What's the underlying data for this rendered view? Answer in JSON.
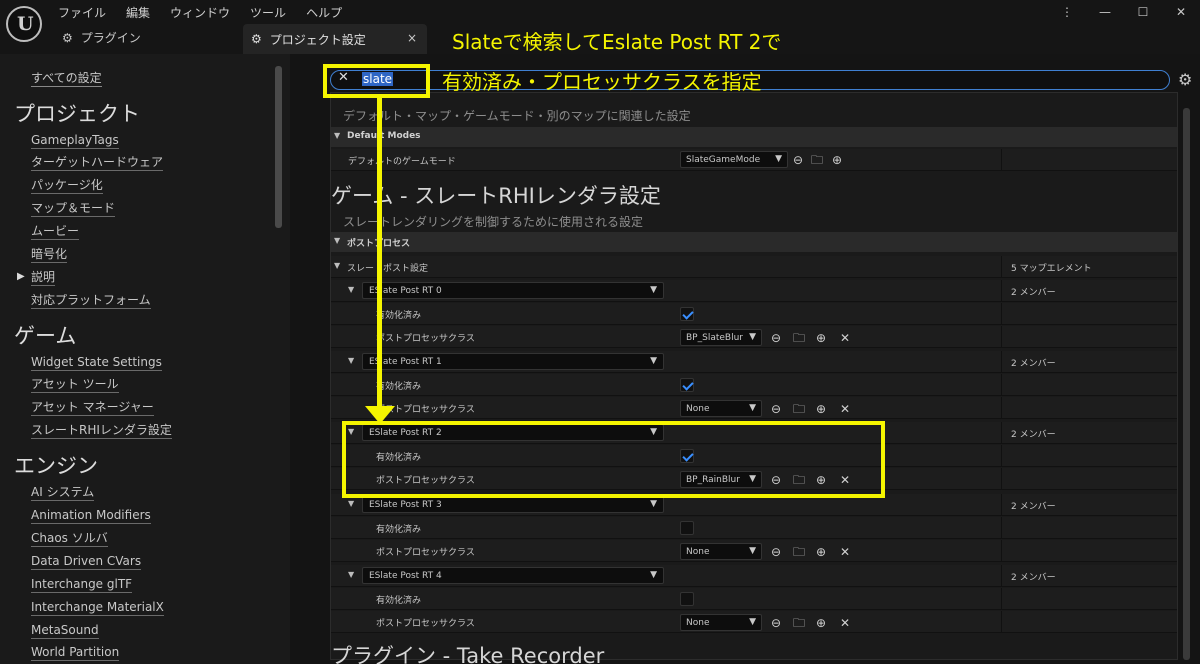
{
  "menu": [
    "ファイル",
    "編集",
    "ウィンドウ",
    "ツール",
    "ヘルプ"
  ],
  "window_controls": [
    "⋮",
    "—",
    "☐",
    "✕"
  ],
  "tabs": {
    "plugin": "プラグイン",
    "project": "プロジェクト設定",
    "close": "×"
  },
  "sidebar": {
    "all": "すべての設定",
    "project_title": "プロジェクト",
    "project_items": [
      "GameplayTags",
      "ターゲットハードウェア",
      "パッケージ化",
      "マップ＆モード",
      "ムービー",
      "暗号化",
      "説明",
      "対応プラットフォーム"
    ],
    "game_title": "ゲーム",
    "game_items": [
      "Widget State Settings",
      "アセット ツール",
      "アセット マネージャー",
      "スレートRHIレンダラ設定"
    ],
    "engine_title": "エンジン",
    "engine_items": [
      "AI システム",
      "Animation Modifiers",
      "Chaos ソルバ",
      "Data Driven CVars",
      "Interchange glTF",
      "Interchange MaterialX",
      "MetaSound",
      "World Partition"
    ]
  },
  "search": {
    "value": "slate"
  },
  "content": {
    "maps_desc": "デフォルト・マップ・ゲームモード・別のマップに関連した設定",
    "default_modes": "Default Modes",
    "default_gamemode_label": "デフォルトのゲームモード",
    "default_gamemode_value": "SlateGameMode",
    "section_title": "ゲーム - スレートRHIレンダラ設定",
    "section_desc": "スレートレンダリングを制御するために使用される設定",
    "postprocess": "ポストプロセス",
    "slate_post_label": "スレートポスト設定",
    "slate_post_value": "5 マップエレメント",
    "elements": [
      {
        "name": "ESlate Post RT 0",
        "members": "2 メンバー",
        "enabled_label": "有効化済み",
        "class_label": "ポストプロセッサクラス",
        "class_value": "BP_SlateBlur"
      },
      {
        "name": "ESlate Post RT 1",
        "members": "2 メンバー",
        "enabled_label": "有効化済み",
        "class_label": "ポストプロセッサクラス",
        "class_value": "None"
      },
      {
        "name": "ESlate Post RT 2",
        "members": "2 メンバー",
        "enabled_label": "有効化済み",
        "class_label": "ポストプロセッサクラス",
        "class_value": "BP_RainBlur"
      },
      {
        "name": "ESlate Post RT 3",
        "members": "2 メンバー",
        "enabled_label": "有効化済み",
        "class_label": "ポストプロセッサクラス",
        "class_value": "None"
      },
      {
        "name": "ESlate Post RT 4",
        "members": "2 メンバー",
        "enabled_label": "有効化済み",
        "class_label": "ポストプロセッサクラス",
        "class_value": "None"
      }
    ],
    "next_section": "プラグイン - Take Recorder"
  },
  "annotation": {
    "line1": "Slateで検索してEslate Post RT 2で",
    "line2": "有効済み・プロセッサクラスを指定"
  },
  "icons": {
    "arrow": "⊖",
    "browse": "🗀",
    "add": "⊕",
    "clear": "✕"
  }
}
